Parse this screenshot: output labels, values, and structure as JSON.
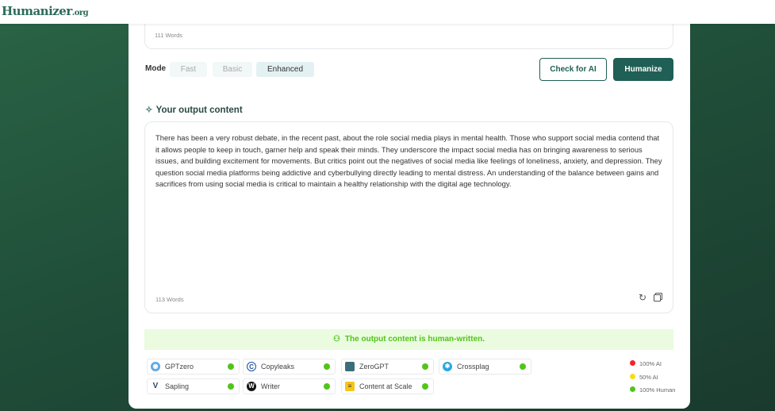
{
  "header": {
    "logo_main": "Humanizer",
    "logo_suffix": ".org"
  },
  "input": {
    "word_count": "111 Words"
  },
  "mode": {
    "label": "Mode",
    "options": [
      "Fast",
      "Basic",
      "Enhanced"
    ],
    "selected": "Enhanced"
  },
  "actions": {
    "check": "Check for AI",
    "humanize": "Humanize"
  },
  "output": {
    "title": "Your output content",
    "text": "There has been a very robust debate, in the recent past, about the role social media plays in mental health. Those who support social media contend that it allows people to keep in touch, garner help and speak their minds. They underscore the impact social media has on bringing awareness to serious issues, and building excitement for movements. But critics point out the negatives of social media like feelings of loneliness, anxiety, and depression. They question social media platforms being addictive and cyberbullying directly leading to mental distress. An understanding of the balance between gains and sacrifices from using social media is critical to maintain a healthy relationship with the digital age technology.",
    "word_count": "113 Words"
  },
  "result": {
    "banner": "The output content is human-written."
  },
  "detectors": [
    {
      "name": "GPTzero",
      "status": "100% Human"
    },
    {
      "name": "Copyleaks",
      "status": "100% Human"
    },
    {
      "name": "ZeroGPT",
      "status": "100% Human"
    },
    {
      "name": "Crossplag",
      "status": "100% Human"
    },
    {
      "name": "Sapling",
      "status": "100% Human"
    },
    {
      "name": "Writer",
      "status": "100% Human"
    },
    {
      "name": "Content at Scale",
      "status": "100% Human"
    }
  ],
  "legend": [
    {
      "label": "100% AI",
      "color": "#f5222d"
    },
    {
      "label": "50% AI",
      "color": "#fadb14"
    },
    {
      "label": "100% Human",
      "color": "#52c41a"
    }
  ],
  "colors": {
    "accent": "#1f5f55",
    "human": "#52c41a"
  }
}
